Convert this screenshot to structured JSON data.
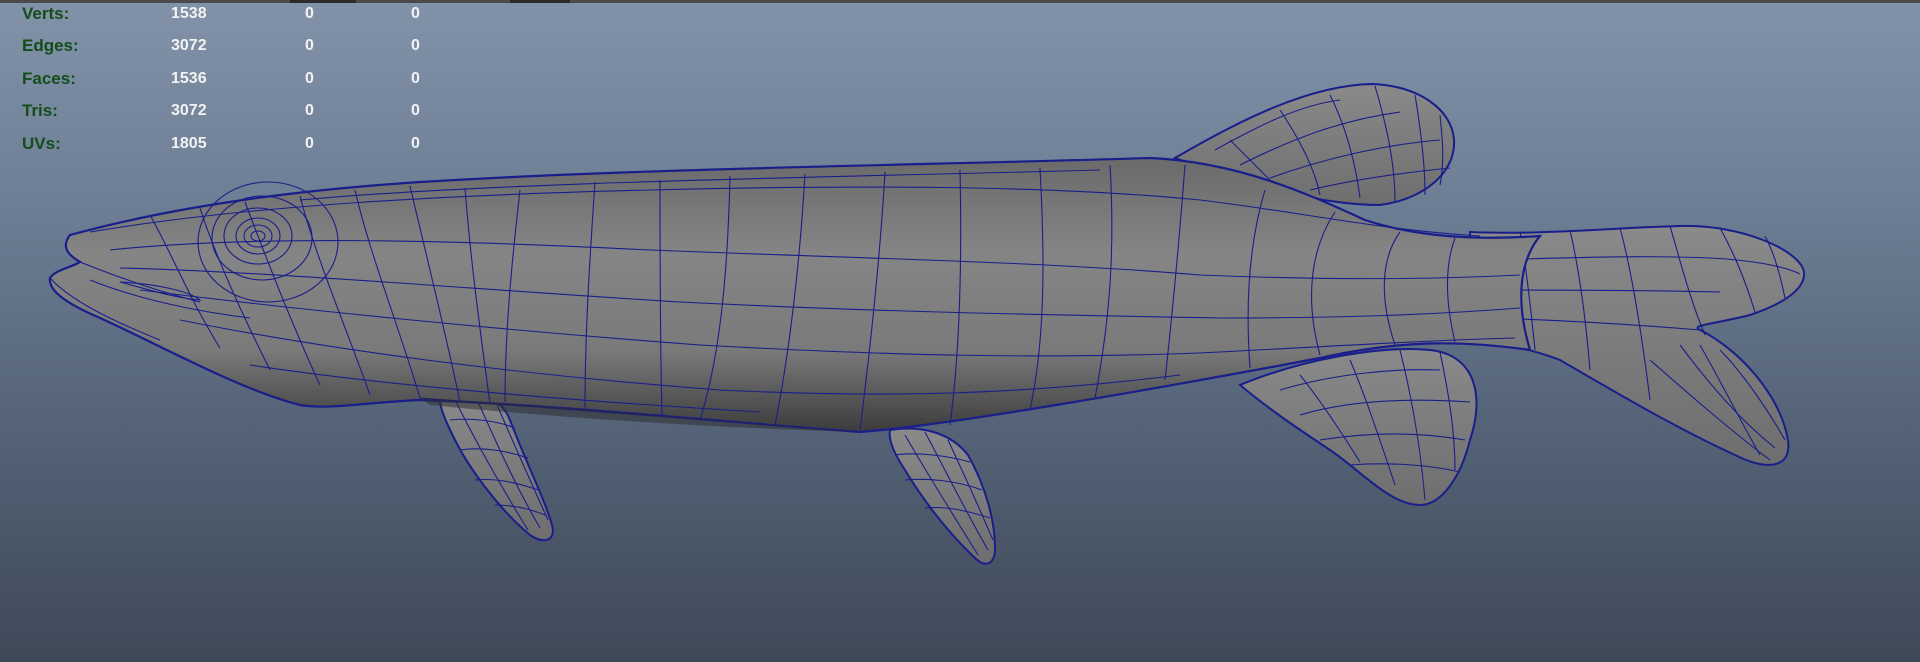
{
  "hud": {
    "rows": [
      {
        "label": "Verts:",
        "values": [
          "1538",
          "0",
          "0"
        ]
      },
      {
        "label": "Edges:",
        "values": [
          "3072",
          "0",
          "0"
        ]
      },
      {
        "label": "Faces:",
        "values": [
          "1536",
          "0",
          "0"
        ]
      },
      {
        "label": "Tris:",
        "values": [
          "3072",
          "0",
          "0"
        ]
      },
      {
        "label": "UVs:",
        "values": [
          "1805",
          "0",
          "0"
        ]
      }
    ]
  },
  "viewport": {
    "object": "fish-mesh",
    "display": "wireframe-on-shaded",
    "colors": {
      "background_top": "#8192a9",
      "background_bottom": "#3e4958",
      "mesh_fill": "#7b7b7b",
      "wireframe": "#1a1e8a",
      "hud_label": "#134d19",
      "hud_value": "#f2f2f2"
    }
  }
}
